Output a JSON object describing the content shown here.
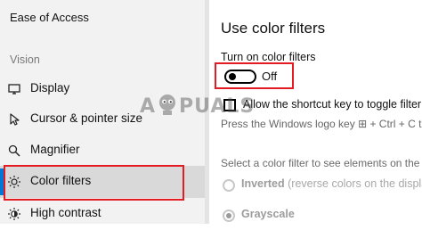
{
  "sidebar": {
    "title": "Ease of Access",
    "section": "Vision",
    "items": [
      {
        "label": "Display",
        "icon": "monitor-icon"
      },
      {
        "label": "Cursor & pointer size",
        "icon": "cursor-icon"
      },
      {
        "label": "Magnifier",
        "icon": "magnifier-icon"
      },
      {
        "label": "Color filters",
        "icon": "sun-icon",
        "selected": true
      },
      {
        "label": "High contrast",
        "icon": "contrast-icon"
      }
    ]
  },
  "main": {
    "title": "Use color filters",
    "toggle": {
      "caption": "Turn on color filters",
      "state": "Off"
    },
    "shortcut_checkbox": {
      "label": "Allow the shortcut key to toggle filter on o",
      "checked": false
    },
    "shortcut_hint": "Press the Windows logo key ⊞ + Ctrl + C to toggle",
    "select_hint": "Select a color filter to see elements on the scre",
    "filters": [
      {
        "name": "Inverted",
        "description": "(reverse colors on the display)",
        "selected": false
      },
      {
        "name": "Grayscale",
        "description": "",
        "selected": true
      }
    ]
  },
  "watermark": {
    "text_left": "A",
    "text_right": "PUALS"
  },
  "colors": {
    "accent": "#0078d7",
    "highlight_box": "#e31b23",
    "sidebar_bg": "#f2f2f2"
  }
}
